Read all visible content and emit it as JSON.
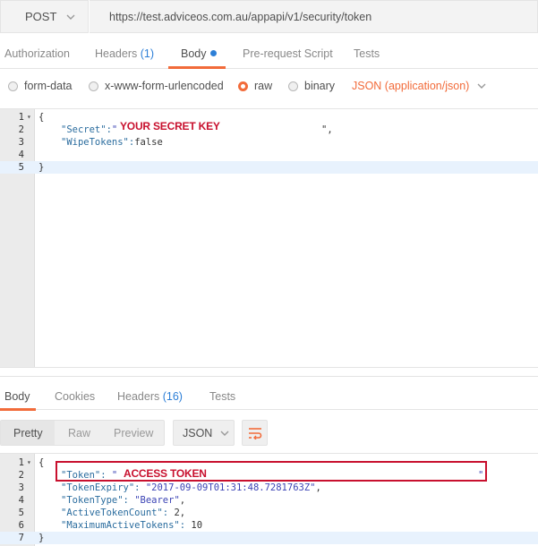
{
  "request": {
    "method": "POST",
    "url": "https://test.adviceos.com.au/appapi/v1/security/token"
  },
  "request_tabs": {
    "authorization": "Authorization",
    "headers": "Headers",
    "headers_count": "(1)",
    "body": "Body",
    "prerequest": "Pre-request Script",
    "tests": "Tests"
  },
  "body_options": {
    "form_data": "form-data",
    "urlencoded": "x-www-form-urlencoded",
    "raw": "raw",
    "binary": "binary",
    "selected": "raw",
    "content_type": "JSON (application/json)"
  },
  "request_editor": {
    "line_numbers": [
      "1",
      "2",
      "3",
      "4",
      "5"
    ],
    "open_brace": "{",
    "secret_key": "\"Secret\":",
    "secret_open_quote": "\"",
    "secret_annotation": "YOUR SECRET KEY",
    "secret_close": "\",",
    "wipe_key": "\"WipeTokens\":",
    "wipe_value": "false",
    "close_brace": "}"
  },
  "response_tabs": {
    "body": "Body",
    "cookies": "Cookies",
    "headers": "Headers",
    "headers_count": "(16)",
    "tests": "Tests"
  },
  "response_toolbar": {
    "pretty": "Pretty",
    "raw": "Raw",
    "preview": "Preview",
    "format": "JSON"
  },
  "response_editor": {
    "line_numbers": [
      "1",
      "2",
      "3",
      "4",
      "5",
      "6",
      "7"
    ],
    "open_brace": "{",
    "token_key": "\"Token\":",
    "token_open_quote": "\"",
    "token_annotation": "ACCESS TOKEN",
    "token_close_quote": "\"",
    "expiry_key": "\"TokenExpiry\":",
    "expiry_value": "\"2017-09-09T01:31:48.7281763Z\"",
    "type_key": "\"TokenType\":",
    "type_value": "\"Bearer\"",
    "active_key": "\"ActiveTokenCount\":",
    "active_value": "2",
    "max_key": "\"MaximumActiveTokens\":",
    "max_value": "10",
    "close_brace": "}"
  },
  "colors": {
    "accent": "#f26b3a",
    "count_blue": "#2d7fd7",
    "annotation_red": "#c8102e"
  }
}
